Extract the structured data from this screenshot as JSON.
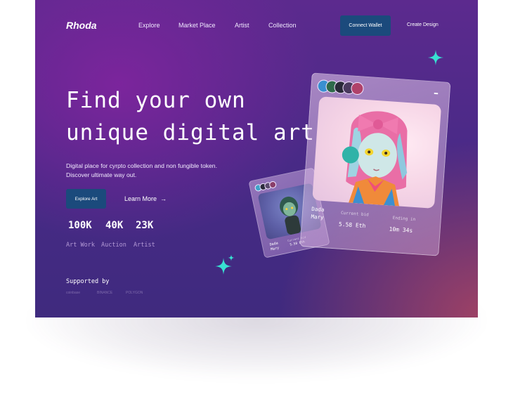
{
  "brand": "Rhoda",
  "nav": {
    "items": [
      "Explore",
      "Market Place",
      "Artist",
      "Collection"
    ],
    "connect_wallet": "Connect Wallet",
    "create_design": "Create Design"
  },
  "hero": {
    "line1": "Find your own",
    "line2": "unique digital art",
    "description_line1": "Digital place for cyrpto collection and non fungible token.",
    "description_line2": "Discover ultimate way out.",
    "primary_button": "Explore Art",
    "secondary_button": "Learn More",
    "arrow": "→"
  },
  "stats": [
    {
      "value": "100K",
      "label": "Art Work"
    },
    {
      "value": "40K",
      "label": "Auction"
    },
    {
      "value": "23K",
      "label": "Artist"
    }
  ],
  "supported": {
    "title": "Supported by",
    "partners": [
      "coinbase",
      "BINANCE",
      "POLYGON"
    ]
  },
  "featured_card": {
    "artist_first": "Dada",
    "artist_last": "Mary",
    "bid_label": "Current bid",
    "bid_value": "5.58 Eth",
    "ending_label": "Ending in",
    "ending_value": "10m 34s",
    "more": "•••"
  },
  "small_card": {
    "artist_first": "Dada",
    "artist_last": "Mary",
    "bid_label": "Current bid",
    "bid_value": "5.58 Eth"
  },
  "colors": {
    "accent_button": "#1b4a7c",
    "sparkle": "#38e0d2",
    "background_top": "#5c2a8e",
    "background_bottom_right": "#b04660"
  }
}
